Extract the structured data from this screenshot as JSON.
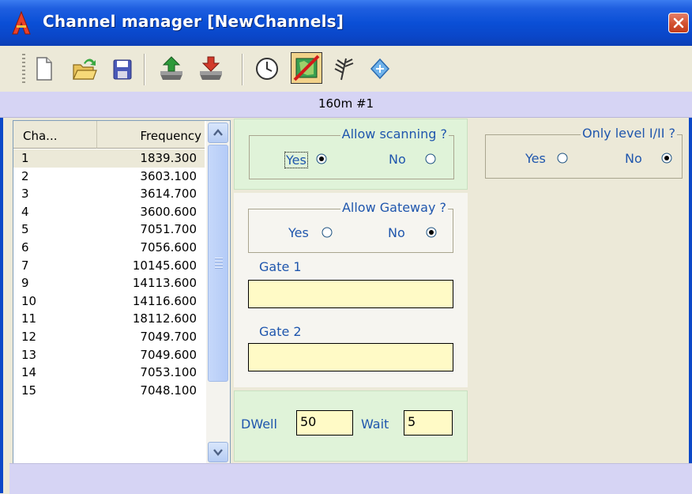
{
  "window": {
    "title": "Channel manager [NewChannels]"
  },
  "toolbar": {
    "buttons": [
      "new-file-icon",
      "open-folder-icon",
      "save-icon",
      "upload-icon",
      "download-icon",
      "clock-icon",
      "map-disabled-icon",
      "antenna-icon",
      "diamond-icon"
    ]
  },
  "channel_header": "160m #1",
  "list": {
    "col_cha": "Cha...",
    "col_freq": "Frequency",
    "rows": [
      {
        "ch": "1",
        "freq": "1839.300"
      },
      {
        "ch": "2",
        "freq": "3603.100"
      },
      {
        "ch": "3",
        "freq": "3614.700"
      },
      {
        "ch": "4",
        "freq": "3600.600"
      },
      {
        "ch": "5",
        "freq": "7051.700"
      },
      {
        "ch": "6",
        "freq": "7056.600"
      },
      {
        "ch": "7",
        "freq": "10145.600"
      },
      {
        "ch": "9",
        "freq": "14113.600"
      },
      {
        "ch": "10",
        "freq": "14116.600"
      },
      {
        "ch": "11",
        "freq": "18112.600"
      },
      {
        "ch": "12",
        "freq": "7049.700"
      },
      {
        "ch": "13",
        "freq": "7049.600"
      },
      {
        "ch": "14",
        "freq": "7053.100"
      },
      {
        "ch": "15",
        "freq": "7048.100"
      }
    ]
  },
  "scanning": {
    "title": "Allow scanning ?",
    "yes": "Yes",
    "no": "No",
    "selected": "yes"
  },
  "level": {
    "title": "Only level I/II ?",
    "yes": "Yes",
    "no": "No",
    "selected": "no"
  },
  "gateway": {
    "title": "Allow Gateway ?",
    "yes": "Yes",
    "no": "No",
    "selected": "no",
    "gate1_label": "Gate 1",
    "gate1_value": "",
    "gate2_label": "Gate 2",
    "gate2_value": ""
  },
  "timing": {
    "dwell_label": "DWell",
    "dwell_value": "50",
    "wait_label": "Wait",
    "wait_value": "5"
  },
  "colors": {
    "title_bar": "#0a4fd6",
    "header_band": "#d6d4f4",
    "green_panel": "#e0f3d9",
    "input_bg": "#fffac6",
    "label_blue": "#1f56ad"
  }
}
